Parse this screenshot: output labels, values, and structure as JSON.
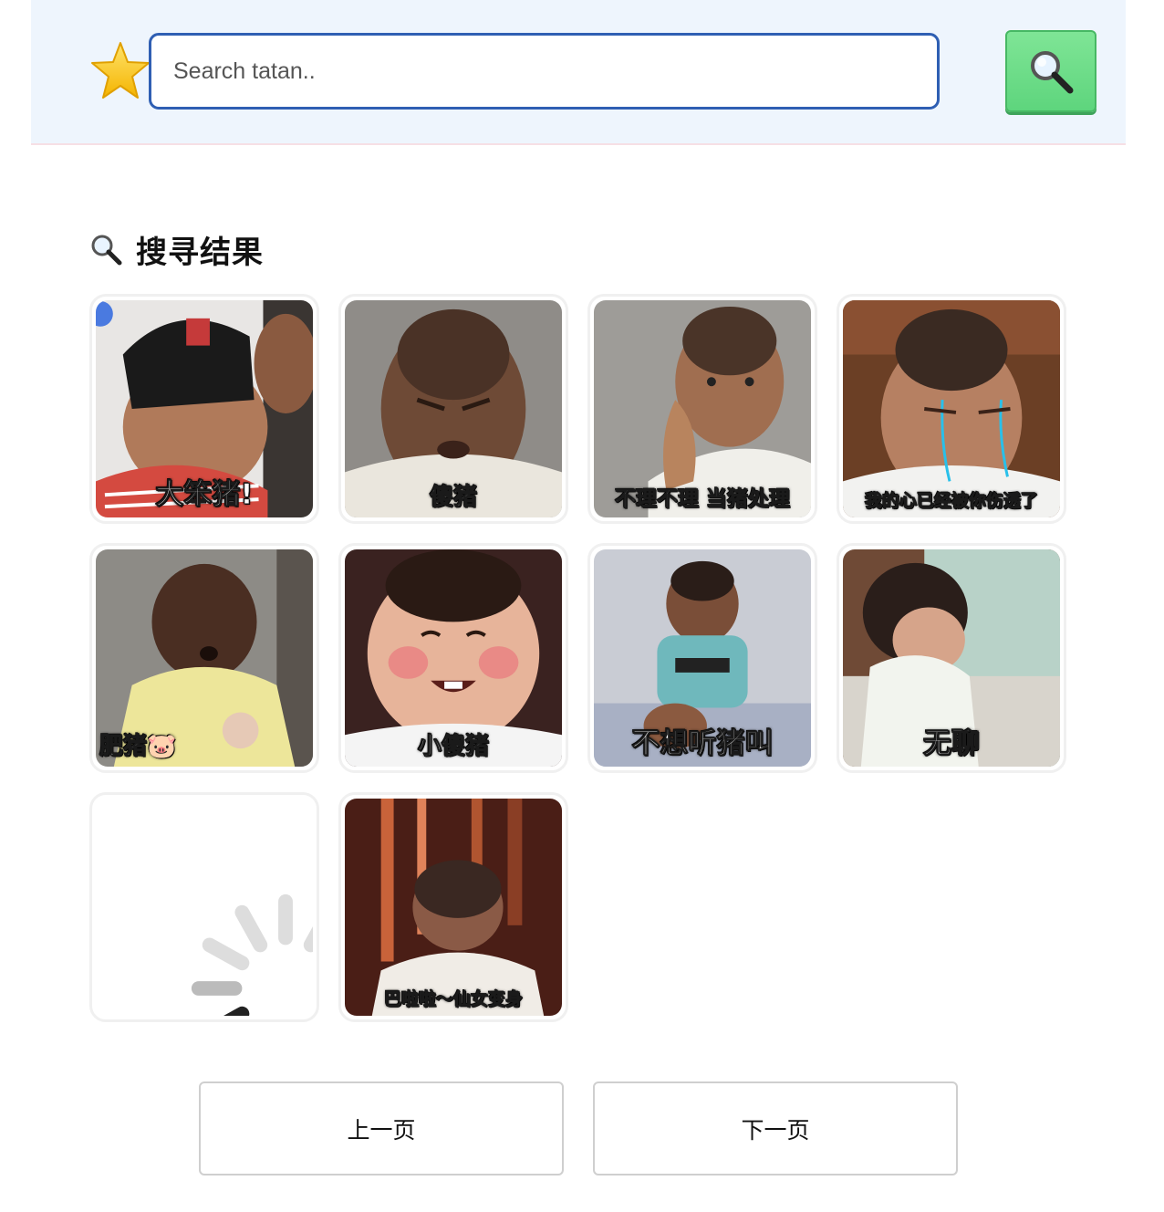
{
  "header": {
    "star_icon": "star-icon",
    "search": {
      "placeholder": "Search tatan..",
      "value": ""
    },
    "search_button_icon": "magnifier-icon",
    "accent_color": "#5ed57d",
    "border_color": "#2f5fb3"
  },
  "results": {
    "icon": "magnifier-icon",
    "title": "搜寻结果",
    "items": [
      {
        "caption": "大笨猪!",
        "state": "loaded"
      },
      {
        "caption": "傻猪",
        "state": "loaded"
      },
      {
        "caption": "不理不理 当猪处理",
        "state": "loaded"
      },
      {
        "caption": "我的心已经被你伤透了",
        "state": "loaded"
      },
      {
        "caption": "肥猪🐷",
        "state": "loaded"
      },
      {
        "caption": "小傻猪",
        "state": "loaded"
      },
      {
        "caption": "不想听猪叫",
        "state": "loaded"
      },
      {
        "caption": "无聊",
        "state": "loaded"
      },
      {
        "caption": "",
        "state": "loading"
      },
      {
        "caption": "巴啦啦～仙女变身",
        "state": "loaded"
      }
    ]
  },
  "pagination": {
    "prev_label": "上一页",
    "next_label": "下一页"
  }
}
